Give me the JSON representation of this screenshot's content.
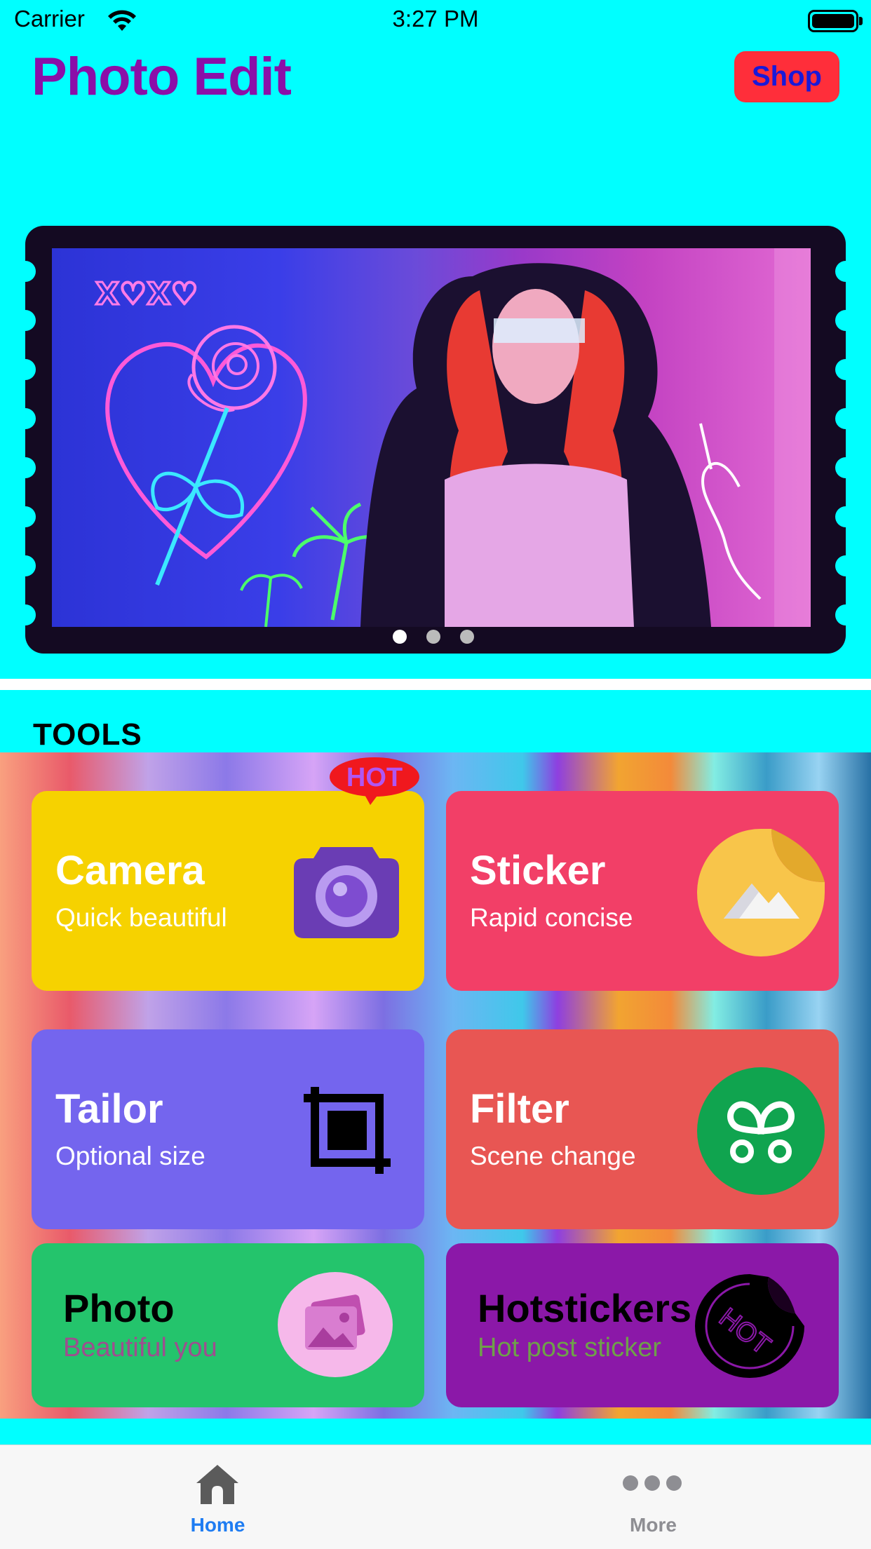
{
  "status_bar": {
    "carrier": "Carrier",
    "time": "3:27 PM"
  },
  "header": {
    "title": "Photo Edit",
    "shop_label": "Shop"
  },
  "banner": {
    "page_count": 3,
    "active_page": 1
  },
  "tools": {
    "section_title": "TOOLS",
    "hot_badge": "HOT",
    "items": [
      {
        "title": "Camera",
        "subtitle": "Quick beautiful",
        "color": "#F6D200",
        "icon": "camera-icon"
      },
      {
        "title": "Sticker",
        "subtitle": "Rapid concise",
        "color": "#F23F67",
        "icon": "sticker-icon"
      },
      {
        "title": "Tailor",
        "subtitle": "Optional size",
        "color": "#7465EE",
        "icon": "crop-icon"
      },
      {
        "title": "Filter",
        "subtitle": "Scene change",
        "color": "#E85653",
        "icon": "filter-icon"
      },
      {
        "title": "Photo",
        "subtitle": "Beautiful you",
        "color": "#24C46C",
        "icon": "gallery-icon"
      },
      {
        "title": "Hotstickers",
        "subtitle": "Hot post sticker",
        "color": "#8B18A8",
        "icon": "hot-sticker-icon",
        "icon_text": "HOT"
      }
    ]
  },
  "tabbar": {
    "tabs": [
      {
        "label": "Home",
        "icon": "home-icon",
        "selected": true,
        "color": "#1E7CF2"
      },
      {
        "label": "More",
        "icon": "more-icon",
        "selected": false,
        "color": "#8E8E93"
      }
    ]
  }
}
